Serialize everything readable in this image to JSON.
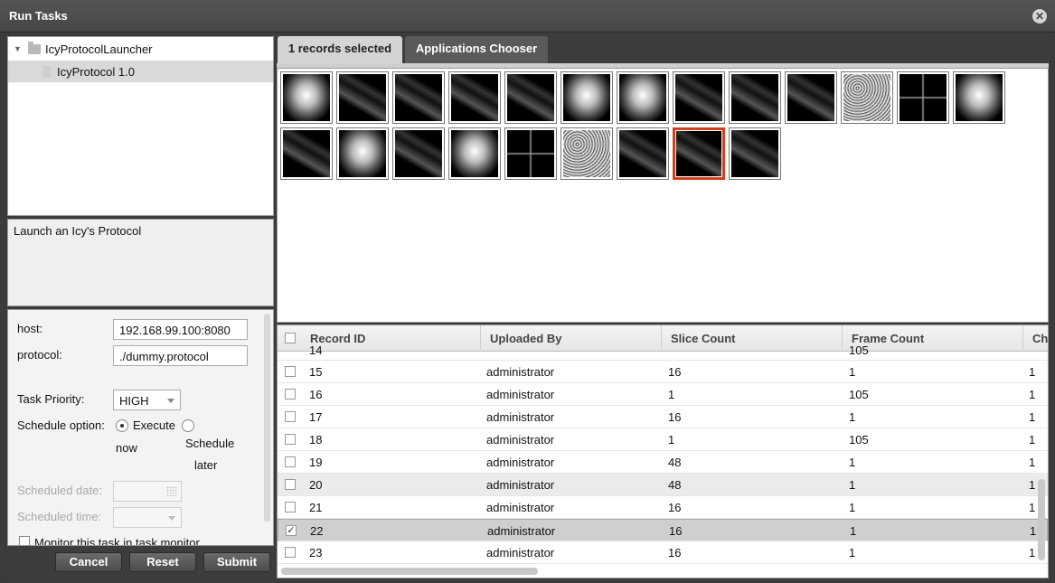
{
  "window": {
    "title": "Run Tasks"
  },
  "tree": {
    "root": "IcyProtocolLauncher",
    "child": "IcyProtocol 1.0"
  },
  "description": "Launch an Icy's Protocol",
  "form": {
    "host_label": "host:",
    "host_value": "192.168.99.100:8080",
    "protocol_label": "protocol:",
    "protocol_value": "./dummy.protocol",
    "priority_label": "Task Priority:",
    "priority_value": "HIGH",
    "schedule_label": "Schedule option:",
    "option_execute": "Execute",
    "option_execute_2": "now",
    "option_schedule": "Schedule",
    "option_schedule_2": "later",
    "date_label": "Scheduled date:",
    "time_label": "Scheduled time:",
    "monitor_label": "Monitor this task in task monitor"
  },
  "buttons": {
    "cancel": "Cancel",
    "reset": "Reset",
    "submit": "Submit"
  },
  "tabs": {
    "selected": "1 records selected",
    "chooser": "Applications Chooser"
  },
  "thumbnails": {
    "row1": [
      "bright",
      "fiber",
      "fiber",
      "fiber",
      "fiber",
      "bright",
      "bright",
      "fiber",
      "fiber",
      "fiber",
      "noise",
      "cross",
      "bright"
    ],
    "row2": [
      "fiber",
      "bright",
      "fiber",
      "bright",
      "cross",
      "noise",
      "fiber",
      "fiber",
      "fiber"
    ],
    "selected_row2_index": 7
  },
  "table": {
    "columns": [
      "Record ID",
      "Uploaded By",
      "Slice Count",
      "Frame Count",
      "Ch"
    ],
    "partial_top": {
      "id": "14",
      "frame": "105"
    },
    "rows": [
      {
        "id": "15",
        "user": "administrator",
        "slices": "16",
        "frames": "1",
        "ch": "1"
      },
      {
        "id": "16",
        "user": "administrator",
        "slices": "1",
        "frames": "105",
        "ch": "1"
      },
      {
        "id": "17",
        "user": "administrator",
        "slices": "16",
        "frames": "1",
        "ch": "1"
      },
      {
        "id": "18",
        "user": "administrator",
        "slices": "1",
        "frames": "105",
        "ch": "1"
      },
      {
        "id": "19",
        "user": "administrator",
        "slices": "48",
        "frames": "1",
        "ch": "1"
      },
      {
        "id": "20",
        "user": "administrator",
        "slices": "48",
        "frames": "1",
        "ch": "1"
      },
      {
        "id": "21",
        "user": "administrator",
        "slices": "16",
        "frames": "1",
        "ch": "1"
      },
      {
        "id": "22",
        "user": "administrator",
        "slices": "16",
        "frames": "1",
        "ch": "1",
        "checked": true
      },
      {
        "id": "23",
        "user": "administrator",
        "slices": "16",
        "frames": "1",
        "ch": "1"
      }
    ]
  },
  "colors": {
    "accent": "#d3411c",
    "titlebar": "#4a4a4a"
  }
}
